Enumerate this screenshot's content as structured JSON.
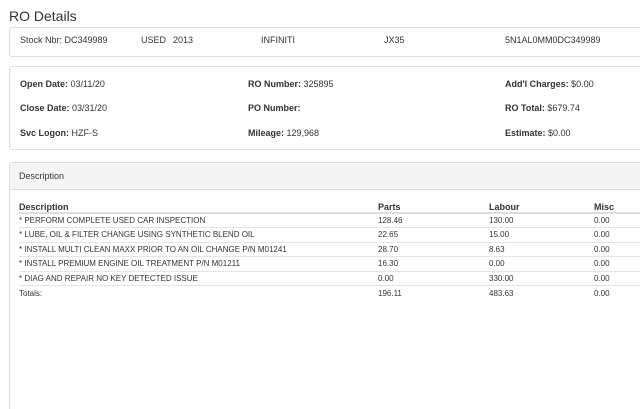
{
  "page": {
    "title": "RO Details"
  },
  "vehicle": {
    "stock": "Stock Nbr: DC349989",
    "condition": "USED",
    "year": "2013",
    "make": "INFINITI",
    "model": "JX35",
    "vin": "5N1AL0MM0DC349989"
  },
  "summary": {
    "open_date_label": "Open Date:",
    "open_date": "03/11/20",
    "close_date_label": "Close Date:",
    "close_date": "03/31/20",
    "svc_logon_label": "Svc Logon:",
    "svc_logon": "HZF-S",
    "ro_number_label": "RO Number:",
    "ro_number": "325895",
    "po_number_label": "PO Number:",
    "po_number": "",
    "mileage_label": "Mileage:",
    "mileage": "129,968",
    "addl_charges_label": "Add'l Charges:",
    "addl_charges": "$0.00",
    "ro_total_label": "RO Total:",
    "ro_total": "$679.74",
    "estimate_label": "Estimate:",
    "estimate": "$0.00"
  },
  "description_panel": {
    "title": "Description",
    "columns": [
      "Description",
      "Parts",
      "Labour",
      "Misc"
    ],
    "rows": [
      {
        "desc": "* PERFORM COMPLETE USED CAR INSPECTION",
        "parts": "128.46",
        "labour": "130.00",
        "misc": "0.00"
      },
      {
        "desc": "* LUBE, OIL & FILTER CHANGE USING SYNTHETIC BLEND OIL",
        "parts": "22.65",
        "labour": "15.00",
        "misc": "0.00"
      },
      {
        "desc": "* INSTALL MULTI CLEAN MAXX PRIOR TO AN OIL CHANGE P/N M01241",
        "parts": "28.70",
        "labour": "8.63",
        "misc": "0.00"
      },
      {
        "desc": "* INSTALL PREMIUM ENGINE OIL TREATMENT P/N M01211",
        "parts": "16.30",
        "labour": "0.00",
        "misc": "0.00"
      },
      {
        "desc": "* DIAG AND REPAIR NO KEY DETECTED ISSUE",
        "parts": "0.00",
        "labour": "330.00",
        "misc": "0.00"
      }
    ],
    "totals": {
      "label": "Totals:",
      "parts": "196.11",
      "labour": "483.63",
      "misc": "0.00"
    }
  }
}
